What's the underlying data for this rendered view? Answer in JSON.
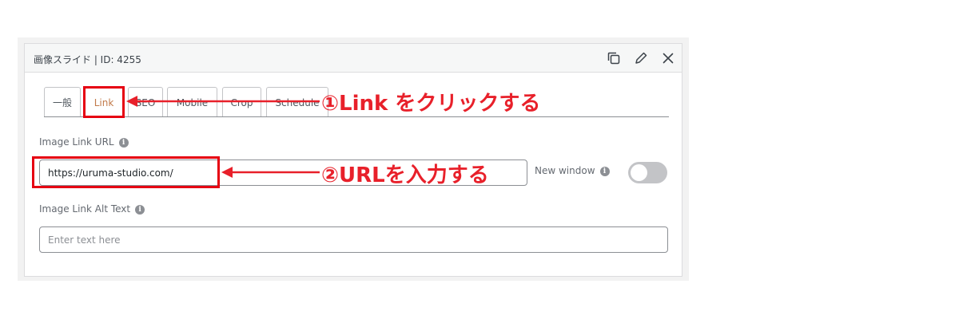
{
  "panel": {
    "title": "画像スライド | ID: 4255"
  },
  "header_icons": [
    "duplicate-icon",
    "edit-pencil-icon",
    "close-icon"
  ],
  "tabs": [
    {
      "label": "一般"
    },
    {
      "label": "Link",
      "active": true
    },
    {
      "label": "SEO"
    },
    {
      "label": "Mobile"
    },
    {
      "label": "Crop"
    },
    {
      "label": "Schedule"
    }
  ],
  "fields": {
    "image_link_url": {
      "label": "Image Link URL",
      "value": "https://uruma-studio.com/"
    },
    "new_window": {
      "label": "New window",
      "enabled": false
    },
    "image_link_alt": {
      "label": "Image Link Alt Text",
      "placeholder": "Enter text here"
    }
  },
  "annotations": {
    "step1": "①Link をクリックする",
    "step2": "②URLを入力する",
    "color": "#e8202a"
  },
  "colors": {
    "active_tab_text": "#c27a4a",
    "highlight_box": "#e60012",
    "toggle_off": "#c3c4c7"
  }
}
